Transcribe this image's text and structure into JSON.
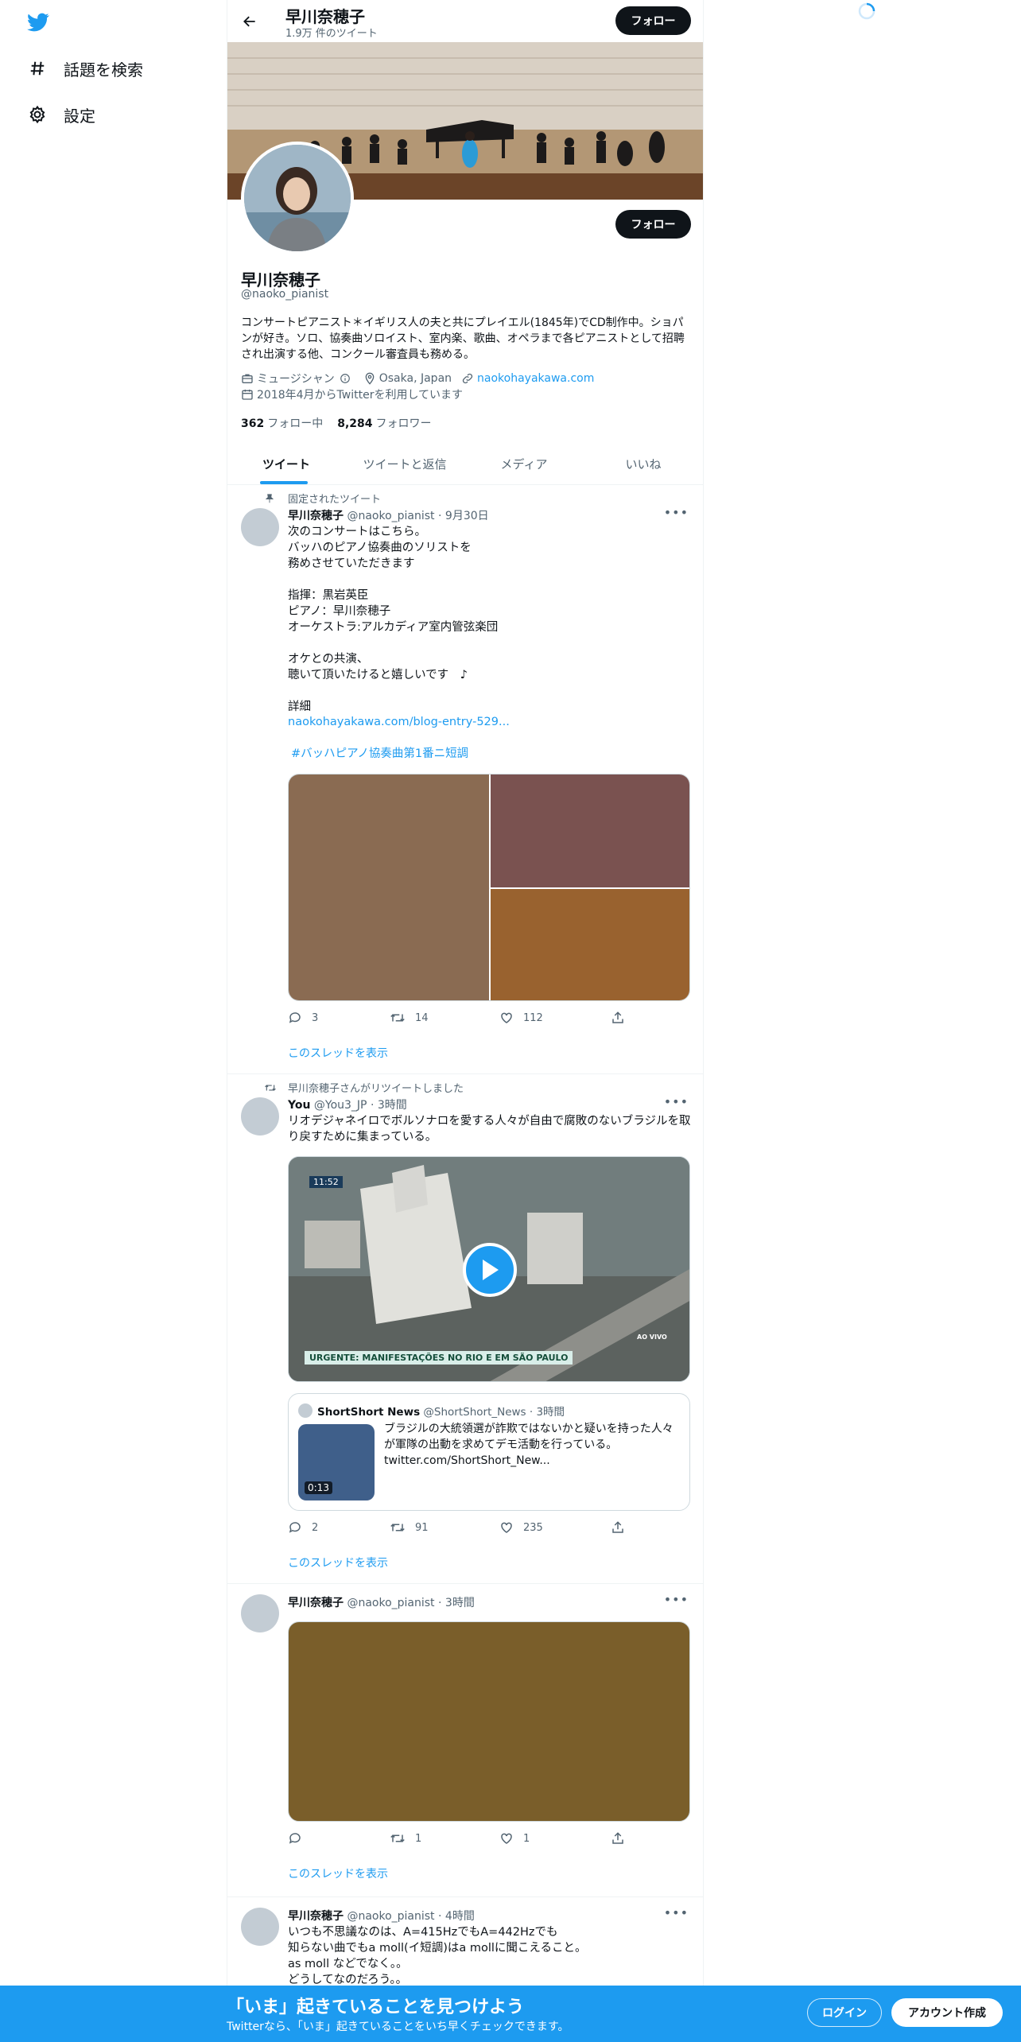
{
  "nav": {
    "logo": "twitter-bird-icon",
    "explore_label": "話題を検索",
    "settings_label": "設定"
  },
  "header": {
    "name": "早川奈穂子",
    "tweet_count": "1.9万 件のツイート",
    "follow_label": "フォロー"
  },
  "profile": {
    "name": "早川奈穂子",
    "handle": "@naoko_pianist",
    "bio": "コンサートピアニスト＊イギリス人の夫と共にプレイエル(1845年)でCD制作中。ショパンが好き。ソロ、協奏曲ソロイスト、室内楽、歌曲、オペラまで各ピアニストとして招聘され出演する他、コンクール審査員も務める。",
    "category": "ミュージシャン",
    "location": "Osaka, Japan",
    "website": "naokohayakawa.com",
    "joined": "2018年4月からTwitterを利用しています",
    "following_count": "362",
    "following_label": "フォロー中",
    "followers_count": "8,284",
    "followers_label": "フォロワー",
    "follow_label": "フォロー"
  },
  "tabs": [
    {
      "label": "ツイート",
      "active": true
    },
    {
      "label": "ツイートと返信",
      "active": false
    },
    {
      "label": "メディア",
      "active": false
    },
    {
      "label": "いいね",
      "active": false
    }
  ],
  "tweets": [
    {
      "context": "固定されたツイート",
      "name": "早川奈穂子",
      "handle": "@naoko_pianist",
      "time": "9月30日",
      "text_lines": "次のコンサートはこちら。\nバッハのピアノ協奏曲のソリストを\n務めさせていただきます\n\n指揮：黒岩英臣\nピアノ：早川奈穂子\nオーケストラ:アルカディア室内管弦楽団\n\nオケとの共演、\n聴いて頂いたけると嬉しいです　♪\n\n詳細",
      "link": "naokohayakawa.com/blog-entry-529...",
      "hashtag": "#バッハピアノ協奏曲第1番ニ短調",
      "replies": "3",
      "retweets": "14",
      "likes": "112",
      "thread_label": "このスレッドを表示",
      "media_colors": [
        "#8a6b52",
        "#7a5250",
        "#99622f"
      ]
    },
    {
      "context": "早川奈穂子さんがリツイートしました",
      "name": "You",
      "handle": "@You3_JP",
      "time": "3時間",
      "text_lines": "リオデジャネイロでボルソナロを愛する人々が自由で腐敗のないブラジルを取り戻すために集まっている。",
      "video_time": "11:52",
      "video_caption": "URGENTE: MANIFESTAÇÕES NO RIO E EM SÃO PAULO",
      "video_live": "AO VIVO",
      "quote": {
        "name": "ShortShort News",
        "handle": "@ShortShort_News",
        "time": "3時間",
        "text": "ブラジルの大統領選が詐欺ではないかと疑いを持った人々が軍隊の出動を求めてデモ活動を行っている。",
        "link": "twitter.com/ShortShort_New...",
        "duration": "0:13"
      },
      "replies": "2",
      "retweets": "91",
      "likes": "235",
      "thread_label": "このスレッドを表示"
    },
    {
      "name": "早川奈穂子",
      "handle": "@naoko_pianist",
      "time": "3時間",
      "media_color": "#7a5e2a",
      "replies": "",
      "retweets": "1",
      "likes": "1",
      "thread_label": "このスレッドを表示"
    },
    {
      "name": "早川奈穂子",
      "handle": "@naoko_pianist",
      "time": "4時間",
      "text_lines": "いつも不思議なのは、A=415HzでもA=442Hzでも\n知らない曲でもa moll(イ短調)はa mollに聞こえること。\nas moll などでなく。。\nどうしてなのだろう。。"
    }
  ],
  "bottom": {
    "title": "「いま」起きていることを見つけよう",
    "subtitle": "Twitterなら、「いま」起きていることをいち早くチェックできます。",
    "login_label": "ログイン",
    "signup_label": "アカウント作成"
  },
  "colors": {
    "accent": "#1d9bf0",
    "text": "#0f1419",
    "secondary": "#536471"
  }
}
